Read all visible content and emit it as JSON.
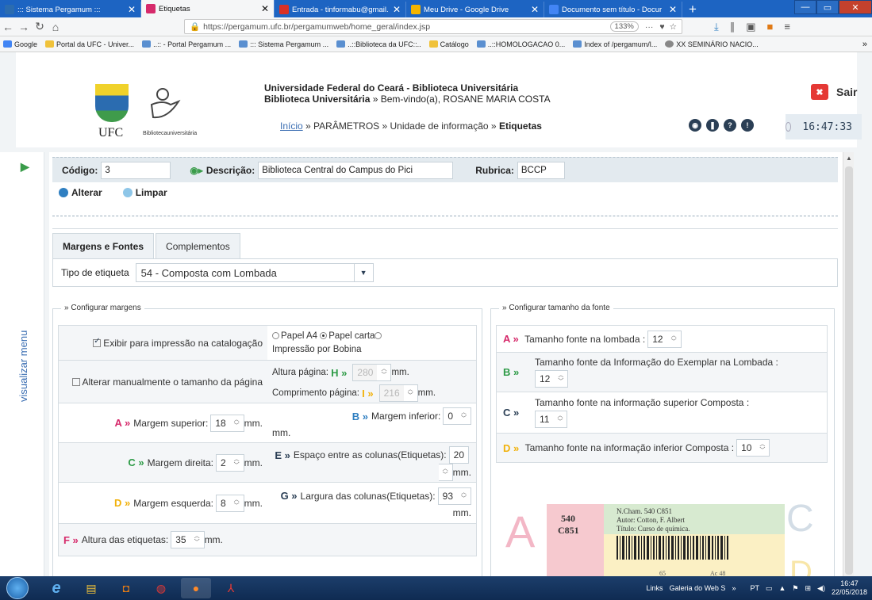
{
  "browser": {
    "tabs": [
      {
        "label": "::: Sistema Pergamum :::",
        "color": "#2b6cb0"
      },
      {
        "label": "Etiquetas",
        "color": "#d62a6b"
      },
      {
        "label": "Entrada - tinformabu@gmail.c",
        "color": "#d93025"
      },
      {
        "label": "Meu Drive - Google Drive",
        "color": "#f4b400"
      },
      {
        "label": "Documento sem título - Docur",
        "color": "#4285f4"
      }
    ],
    "url": "https://pergamum.ufc.br/pergamumweb/home_geral/index.jsp",
    "zoom": "133%",
    "bookmarks": [
      "Google",
      "Portal da UFC - Univer...",
      "..:: - Portal Pergamum ...",
      "::: Sistema Pergamum ...",
      "..::Biblioteca da UFC::..",
      "Catálogo",
      "..::HOMOLOGACAO 0...",
      "Index of /pergamum/l...",
      "XX SEMINÁRIO NACIO..."
    ]
  },
  "header": {
    "logo_text": "UFC",
    "bib_text": "Bibliotecauniversitária",
    "inst_name": "Universidade Federal do Ceará - Biblioteca Universitária",
    "inst_sub_bold": "Biblioteca Universitária",
    "inst_sub_rest": "» Bem-vindo(a), ROSANE MARIA COSTA",
    "crumb_home": "Início",
    "crumb_1": "»  PARÂMETROS  »  Unidade de informação  »",
    "crumb_current": "Etiquetas",
    "logout": "Sair",
    "clock": "16:47:33"
  },
  "sidebar": {
    "menu_label": "visualizar menu"
  },
  "form": {
    "codigo_label": "Código:",
    "codigo_value": "3",
    "descricao_label": "Descrição:",
    "descricao_value": "Biblioteca Central do Campus do Pici",
    "rubrica_label": "Rubrica:",
    "rubrica_value": "BCCP",
    "alterar": "Alterar",
    "limpar": "Limpar"
  },
  "tabs": {
    "active": "Margens e Fontes",
    "inactive": "Complementos"
  },
  "tipo": {
    "label": "Tipo de etiqueta",
    "value": "54 - Composta com Lombada"
  },
  "margens": {
    "legend": "» Configurar margens",
    "exibir": "Exibir para impressão na catalogação",
    "papel_a4": "Papel A4",
    "papel_carta": "Papel carta",
    "impressao": "Impressão por Bobina",
    "alterar_tamanho": "Alterar manualmente o tamanho da página",
    "altura_pagina_label": "Altura página:",
    "altura_pagina_letter": "H »",
    "altura_pagina_value": "280",
    "comprimento_label": "Comprimento página:",
    "comprimento_letter": "I »",
    "comprimento_value": "216",
    "mm": "mm.",
    "a_letter": "A »",
    "a_label": "Margem superior:",
    "a_value": "18",
    "b_letter": "B »",
    "b_label": "Margem inferior:",
    "b_value": "0",
    "c_letter": "C »",
    "c_label": "Margem direita:",
    "c_value": "2",
    "e_letter": "E »",
    "e_label": "Espaço entre as colunas(Etiquetas):",
    "e_value": "20",
    "d_letter": "D »",
    "d_label": "Margem esquerda:",
    "d_value": "8",
    "g_letter": "G »",
    "g_label": "Largura das colunas(Etiquetas):",
    "g_value": "93",
    "f_letter": "F »",
    "f_label": "Altura das etiquetas:",
    "f_value": "35"
  },
  "fontes": {
    "legend": "» Configurar tamanho da fonte",
    "a_letter": "A »",
    "a_label": "Tamanho fonte na lombada :",
    "a_value": "12",
    "b_letter": "B »",
    "b_label": "Tamanho fonte da Informação do Exemplar na Lombada :",
    "b_value": "12",
    "c_letter": "C »",
    "c_label": "Tamanho fonte na informação superior Composta :",
    "c_value": "11",
    "d_letter": "D »",
    "d_label": "Tamanho fonte na informação inferior Composta :",
    "d_value": "10"
  },
  "preview": {
    "call_1": "540",
    "call_2": "C851",
    "ncham": "N.Cham. 540 C851",
    "autor": "Autor: Cotton, F. Albert",
    "titulo": "Título: Curso de química.",
    "code_left": "65",
    "code_right": "Ac 48"
  },
  "taskbar": {
    "links": "Links",
    "galeria": "Galeria do Web S",
    "lang": "PT",
    "time": "16:47",
    "date": "22/05/2018"
  }
}
